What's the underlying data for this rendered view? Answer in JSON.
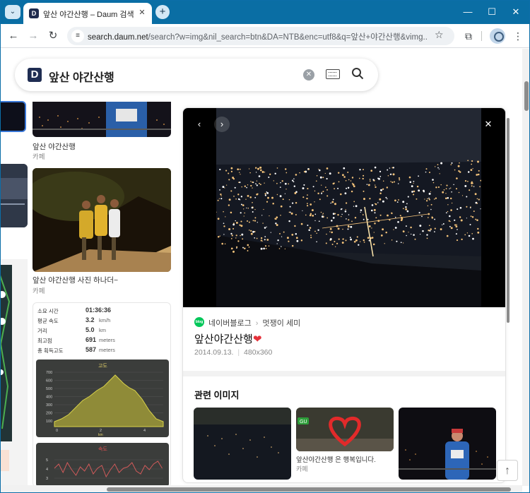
{
  "browser": {
    "tab_title": "앞산 야간산행 – Daum 검색",
    "favicon_letter": "D",
    "url_host": "search.daum.net",
    "url_path": "/search?w=img&nil_search=btn&DA=NTB&enc=utf8&q=앞산+야간산행&vimg..."
  },
  "search": {
    "logo_letter": "D",
    "query": "앞산 야간산행"
  },
  "results": [
    {
      "caption": "앞산 야간산행",
      "source": "카페"
    },
    {
      "caption": "앞산 야간산행 사진 하나더~",
      "source": "카페"
    }
  ],
  "tracker": {
    "rows": [
      {
        "label": "소요 시간",
        "value": "01:36:36",
        "unit": ""
      },
      {
        "label": "평균 속도",
        "value": "3.2",
        "unit": "km/h"
      },
      {
        "label": "거리",
        "value": "5.0",
        "unit": "km"
      },
      {
        "label": "최고점",
        "value": "691",
        "unit": "meters"
      },
      {
        "label": "총 획득고도",
        "value": "587",
        "unit": "meters"
      }
    ],
    "elev_title": "고도",
    "elev_y_ticks": [
      "700",
      "600",
      "500",
      "400",
      "300",
      "200",
      "100"
    ],
    "elev_x_ticks": [
      "0",
      "2",
      "4"
    ],
    "elev_xlabel": "km",
    "speed_title": "속도",
    "speed_y_ticks": [
      "5",
      "4",
      "3"
    ]
  },
  "detail": {
    "blog_icon_text": "blog",
    "source": "네이버블로그",
    "author": "멋쟁이 세미",
    "title": "앞산야간산행",
    "date": "2014.09.13.",
    "size": "480x360",
    "related_heading": "관련 이미지",
    "related_caption": "앞산야간산행 은 행복입니다.",
    "related_source": "카페",
    "gu_badge": "GU"
  },
  "colors": {
    "tabbar": "#0a6ea4",
    "daum_navy": "#1f2d52",
    "blog_green": "#03c75a",
    "heart_red": "#e5313a"
  }
}
